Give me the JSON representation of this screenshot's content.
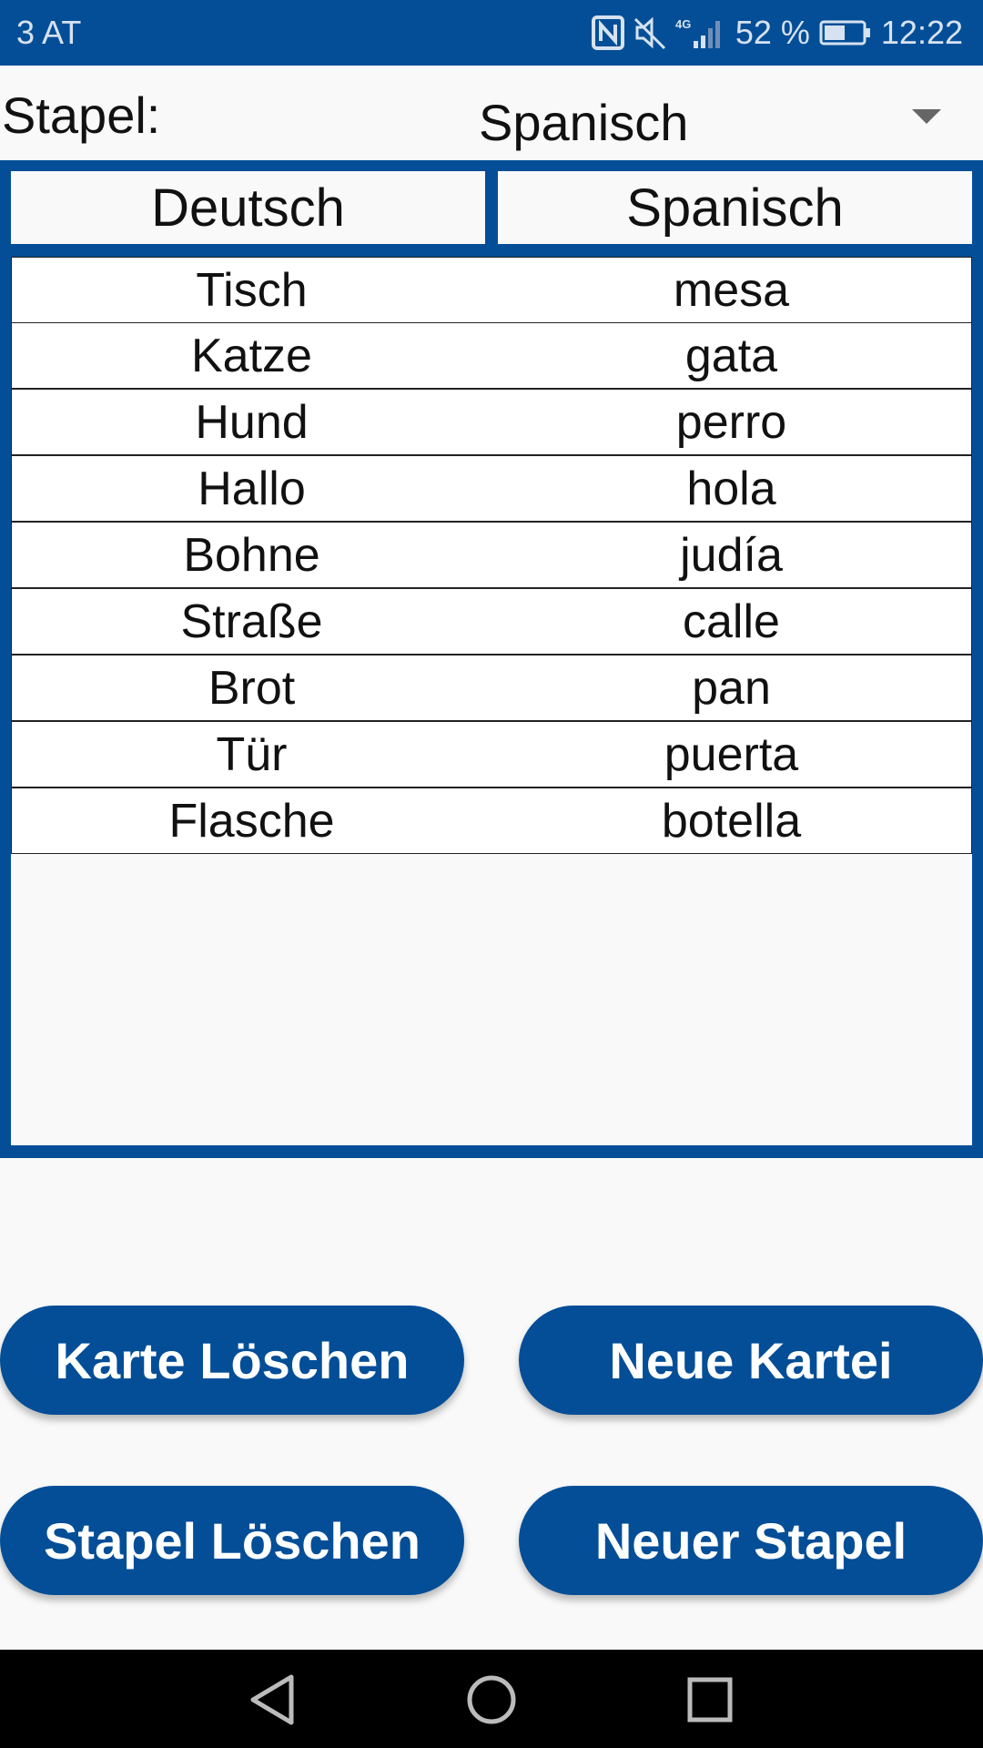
{
  "status_bar": {
    "carrier": "3 AT",
    "network": "4G",
    "battery": "52 %",
    "time": "12:22"
  },
  "deck": {
    "label": "Stapel:",
    "selected": "Spanisch"
  },
  "table": {
    "headers": [
      "Deutsch",
      "Spanisch"
    ],
    "rows": [
      [
        "Tisch",
        "mesa"
      ],
      [
        "Katze",
        "gata"
      ],
      [
        "Hund",
        "perro"
      ],
      [
        "Hallo",
        "hola"
      ],
      [
        "Bohne",
        "judía"
      ],
      [
        "Straße",
        "calle"
      ],
      [
        "Brot",
        "pan"
      ],
      [
        "Tür",
        "puerta"
      ],
      [
        "Flasche",
        "botella"
      ]
    ]
  },
  "buttons": {
    "delete_card": "Karte Löschen",
    "new_card": "Neue Kartei",
    "delete_deck": "Stapel Löschen",
    "new_deck": "Neuer Stapel"
  },
  "colors": {
    "primary": "#034e97",
    "background": "#f9f9f9"
  }
}
